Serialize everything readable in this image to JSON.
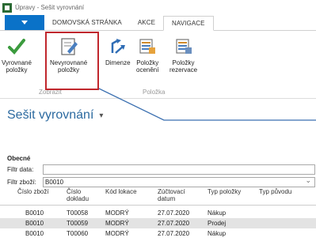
{
  "window": {
    "title": "Úpravy - Sešit vyrovnání"
  },
  "tabs": [
    {
      "label": "DOMOVSKÁ STRÁNKA"
    },
    {
      "label": "AKCE"
    },
    {
      "label": "NAVIGACE"
    }
  ],
  "ribbon": {
    "buttons": [
      {
        "line1": "Vyrovnané",
        "line2": "položky",
        "icon": "checkmark-icon"
      },
      {
        "line1": "Nevyrovnané",
        "line2": "položky",
        "icon": "edit-document-icon"
      },
      {
        "line1": "Dimenze",
        "line2": "",
        "icon": "dimension-icon"
      },
      {
        "line1": "Položky",
        "line2": "ocenění",
        "icon": "value-entries-icon"
      },
      {
        "line1": "Položky",
        "line2": "rezervace",
        "icon": "reservation-entries-icon"
      }
    ],
    "groups": [
      {
        "label": "Zobrazit"
      },
      {
        "label": "Položka"
      }
    ],
    "colors": {
      "accent": "#0a72c8",
      "check": "#3b9b3e",
      "highlight": "#c0272d"
    }
  },
  "page": {
    "title": "Sešit vyrovnání",
    "caret": "▾"
  },
  "general": {
    "section_label": "Obecné",
    "filter_date": {
      "label": "Filtr data:",
      "value": ""
    },
    "filter_item": {
      "label": "Filtr zboží:",
      "value": "B0010"
    }
  },
  "table": {
    "headers": [
      {
        "l1": "Číslo zboží",
        "l2": ""
      },
      {
        "l1": "Číslo",
        "l2": "dokladu"
      },
      {
        "l1": "Kód lokace",
        "l2": ""
      },
      {
        "l1": "Zúčtovací",
        "l2": "datum"
      },
      {
        "l1": "Typ položky",
        "l2": ""
      },
      {
        "l1": "Typ původu",
        "l2": ""
      }
    ],
    "rows": [
      {
        "item": "B0010",
        "doc": "T00058",
        "loc": "MODRÝ",
        "date": "27.07.2020",
        "type": "Nákup",
        "origin": ""
      },
      {
        "item": "B0010",
        "doc": "T00059",
        "loc": "MODRÝ",
        "date": "27.07.2020",
        "type": "Prodej",
        "origin": ""
      },
      {
        "item": "B0010",
        "doc": "T00060",
        "loc": "MODRÝ",
        "date": "27.07.2020",
        "type": "Nákup",
        "origin": ""
      }
    ]
  }
}
